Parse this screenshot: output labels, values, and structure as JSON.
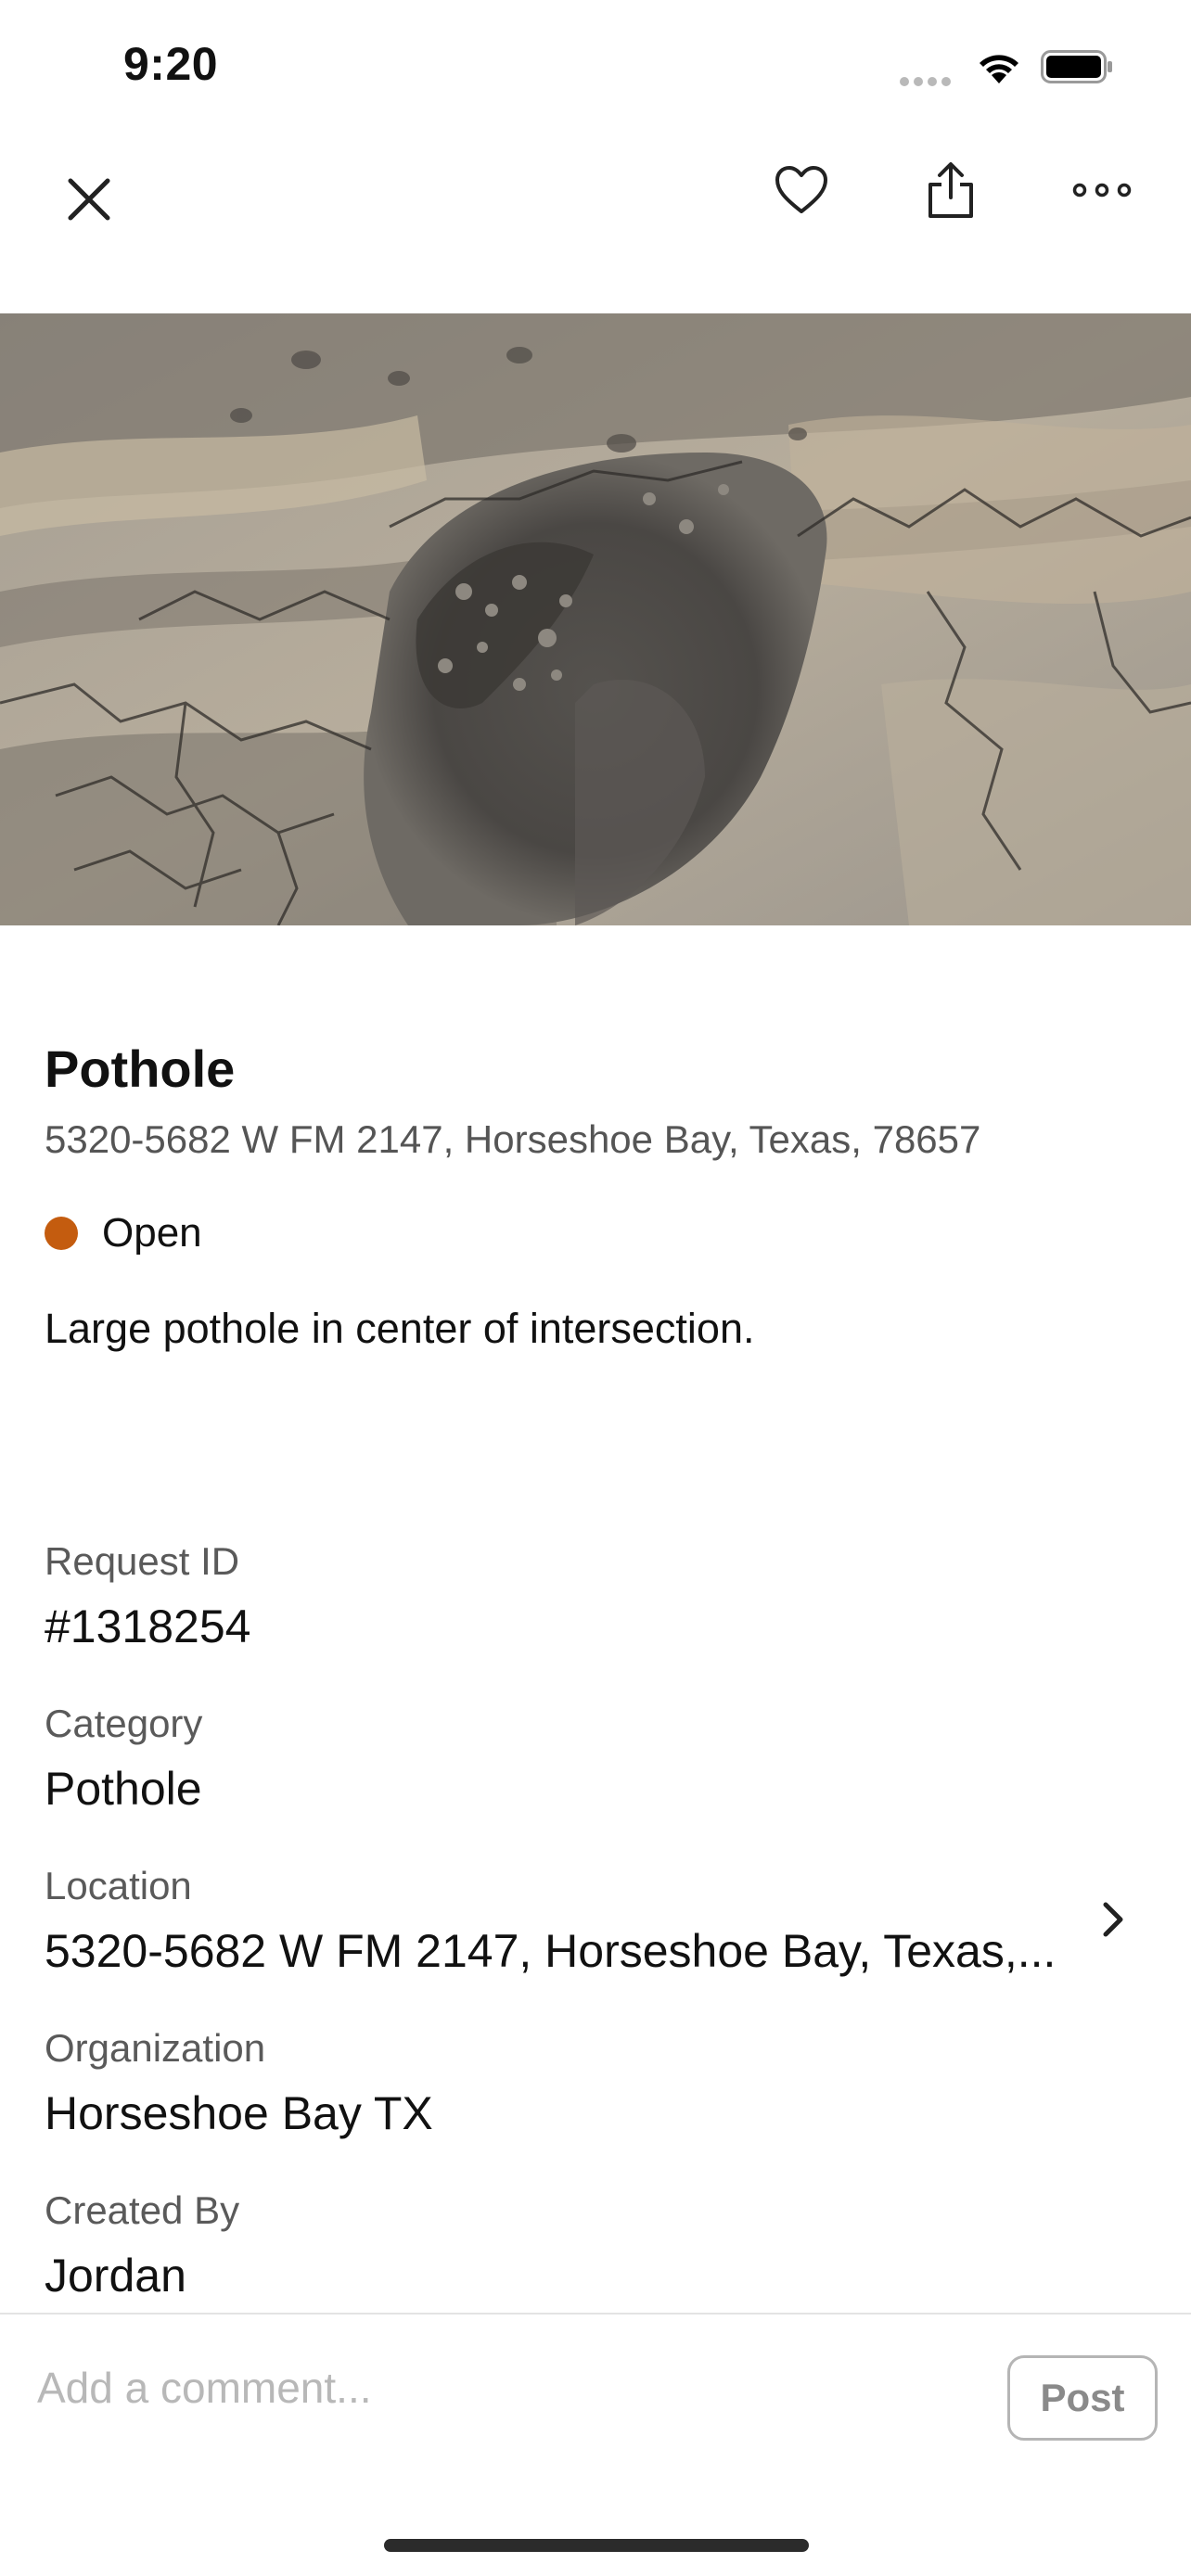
{
  "status_bar": {
    "time": "9:20"
  },
  "nav": {
    "close_icon": "close-icon",
    "favorite_icon": "heart-icon",
    "share_icon": "share-icon",
    "more_icon": "more-icon"
  },
  "photo": {
    "subject": "pothole photo"
  },
  "request": {
    "title": "Pothole",
    "address": "5320-5682 W FM 2147, Horseshoe Bay, Texas, 78657",
    "status": "Open",
    "status_color": "#c45c0f",
    "description": "Large pothole in center of intersection."
  },
  "details": {
    "request_id_label": "Request ID",
    "request_id_value": "#1318254",
    "category_label": "Category",
    "category_value": "Pothole",
    "location_label": "Location",
    "location_value": "5320-5682 W FM 2147, Horseshoe Bay, Texas,...",
    "organization_label": "Organization",
    "organization_value": "Horseshoe Bay TX",
    "created_by_label": "Created By",
    "created_by_value": "Jordan"
  },
  "comment": {
    "placeholder": "Add a comment...",
    "post_label": "Post"
  }
}
